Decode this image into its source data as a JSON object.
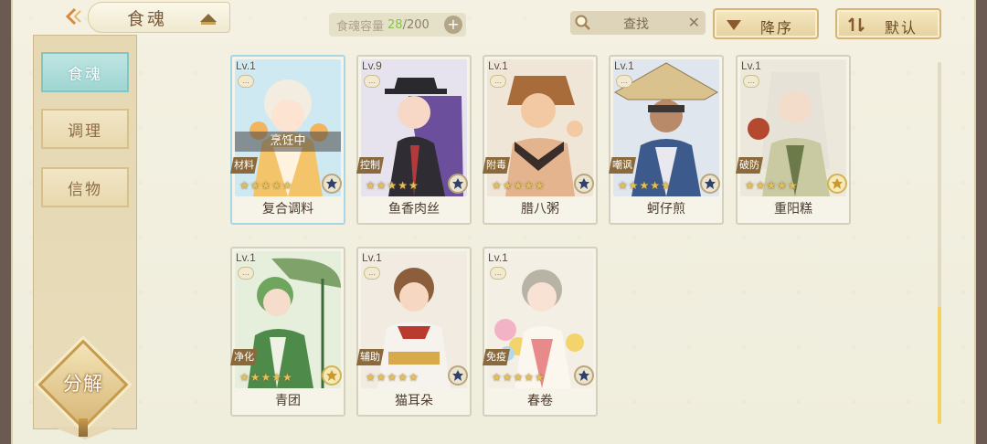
{
  "header": {
    "title": "食魂",
    "capacity_label": "食魂容量",
    "capacity_current": "28",
    "capacity_max": "/200",
    "plus_label": "+",
    "search_label": "查找",
    "search_clear": "✕",
    "sort_label": "降序",
    "filter_label": "默认"
  },
  "sidebar": {
    "items": [
      {
        "label": "食魂",
        "active": true
      },
      {
        "label": "调理",
        "active": false
      },
      {
        "label": "信物",
        "active": false
      }
    ],
    "decompose_label": "分解"
  },
  "cards": [
    {
      "level": "Lv.1",
      "role": "材料",
      "name": "复合调料",
      "status": "烹饪中",
      "stars": "★★★★★"
    },
    {
      "level": "Lv.9",
      "role": "控制",
      "name": "鱼香肉丝",
      "stars": "★★★★★"
    },
    {
      "level": "Lv.1",
      "role": "附毒",
      "name": "腊八粥",
      "stars": "★★★★★"
    },
    {
      "level": "Lv.1",
      "role": "嘲讽",
      "name": "蚵仔煎",
      "stars": "★★★★★"
    },
    {
      "level": "Lv.1",
      "role": "破防",
      "name": "重阳糕",
      "stars": "★★★★★"
    },
    {
      "level": "Lv.1",
      "role": "净化",
      "name": "青团",
      "stars": "★★★★★"
    },
    {
      "level": "Lv.1",
      "role": "辅助",
      "name": "猫耳朵",
      "stars": "★★★★★"
    },
    {
      "level": "Lv.1",
      "role": "免疫",
      "name": "春卷",
      "stars": "★★★★★"
    }
  ],
  "colors": {
    "accent_teal": "#9fd5d3",
    "gold": "#d3b673",
    "capacity_green": "#8bc34a"
  }
}
